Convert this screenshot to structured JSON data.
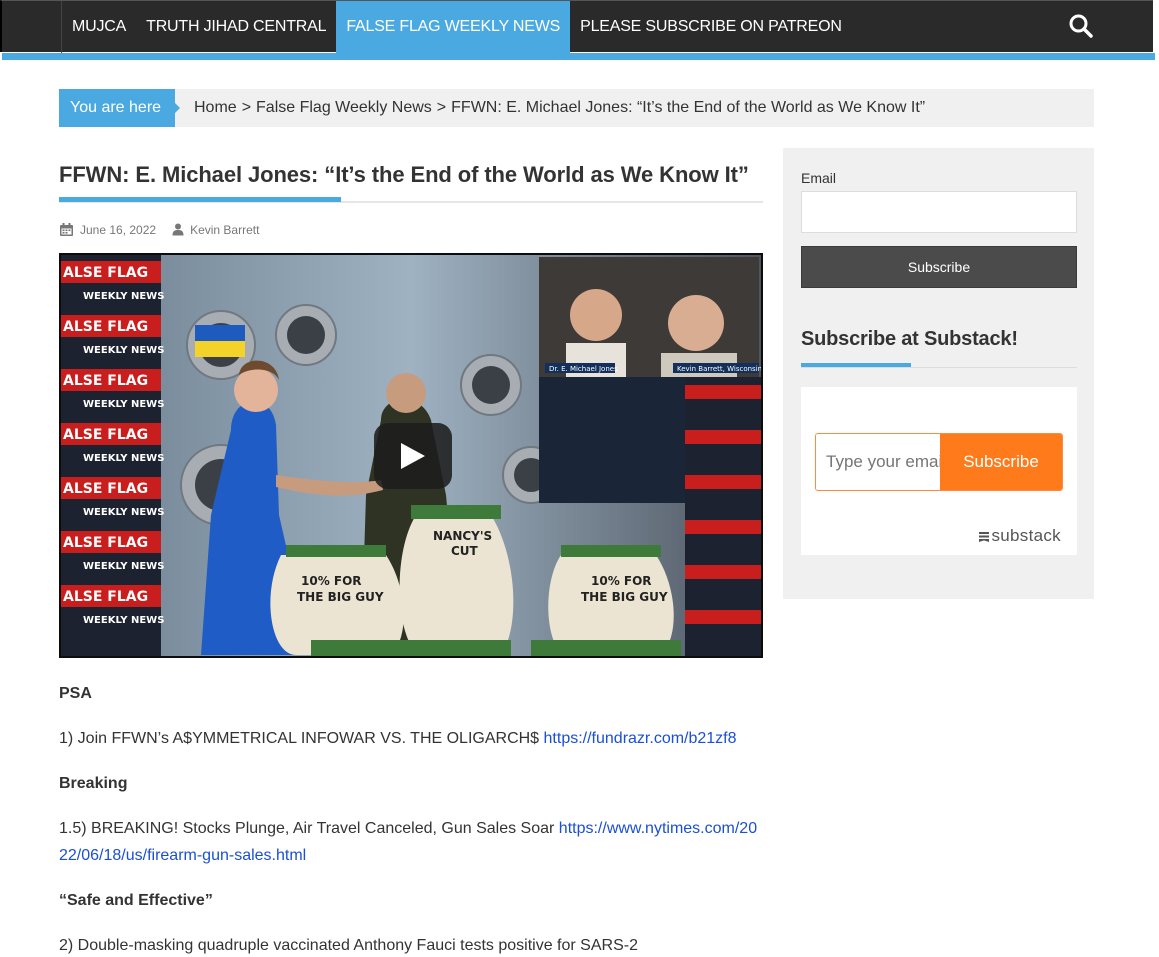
{
  "nav": {
    "items": [
      {
        "label": "MUJCA",
        "active": false
      },
      {
        "label": "TRUTH JIHAD CENTRAL",
        "active": false
      },
      {
        "label": "FALSE FLAG WEEKLY NEWS",
        "active": true
      },
      {
        "label": "PLEASE SUBSCRIBE ON PATREON",
        "active": false
      }
    ],
    "search_icon": "search-icon"
  },
  "breadcrumb": {
    "you_are_here": "You are here",
    "home": "Home",
    "sep": ">",
    "section": "False Flag Weekly News",
    "current": "FFWN: E. Michael Jones: “It’s the End of the World as We Know It”"
  },
  "post": {
    "title": "FFWN: E. Michael Jones: “It’s the End of the World as We Know It”",
    "date": "June 16, 2022",
    "author": "Kevin Barrett",
    "video": {
      "overlay_left": "ALSE FLAG",
      "overlay_left_sub": "WEEKLY NEWS",
      "bag_1": "10% FOR THE BIG GUY",
      "bag_2": "NANCY'S CUT",
      "bag_3": "10% FOR THE BIG GUY",
      "guest_1": "Dr. E. Michael Jones",
      "guest_2": "Kevin Barrett, Wisconsin, US"
    },
    "sections": [
      {
        "heading": "PSA"
      },
      {
        "text": "1) Join FFWN’s A$YMMETRICAL INFOWAR VS. THE OLIGARCH$ ",
        "link": "https://fundrazr.com/b21zf8"
      },
      {
        "heading": "Breaking"
      },
      {
        "text": "1.5) BREAKING! Stocks Plunge, Air Travel Canceled, Gun Sales Soar ",
        "link": "https://www.nytimes.com/2022/06/18/us/firearm-gun-sales.html"
      },
      {
        "heading": "“Safe and Effective”"
      },
      {
        "text": "2) Double-masking quadruple vaccinated Anthony Fauci tests positive for SARS-2"
      }
    ]
  },
  "sidebar": {
    "email_label": "Email",
    "subscribe_label": "Subscribe",
    "widget_title": "Subscribe at Substack!",
    "substack": {
      "placeholder": "Type your email...",
      "button": "Subscribe",
      "brand": "substack",
      "accent": "#ff7a1a"
    }
  },
  "colors": {
    "accent": "#4aa9e0",
    "nav_bg": "#2a2a2a",
    "link": "#1a4fd6"
  }
}
